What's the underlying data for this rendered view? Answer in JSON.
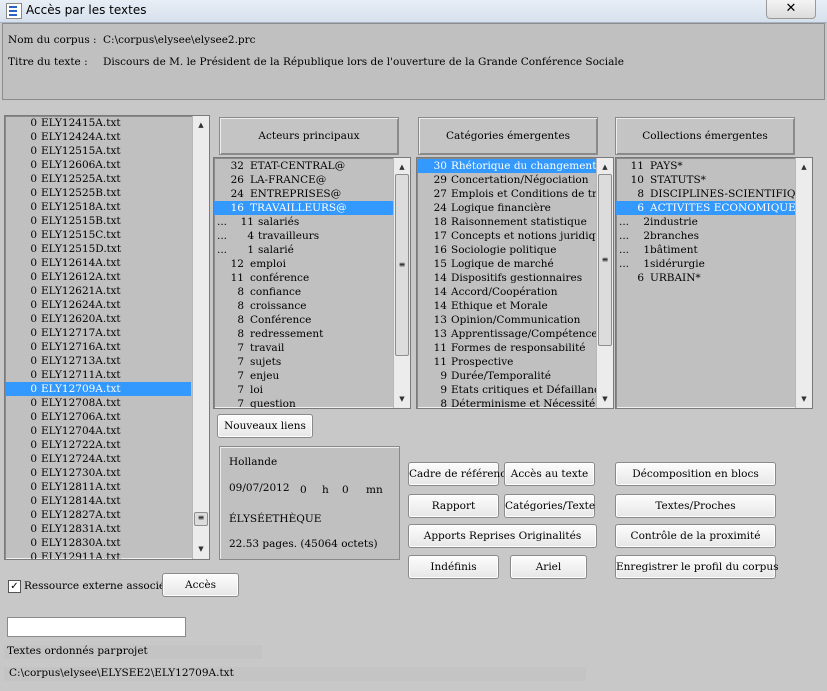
{
  "window": {
    "title": "Accès par les textes",
    "close_glyph": "✕"
  },
  "header": {
    "corpus_label": "Nom du corpus :",
    "corpus_value": "C:\\corpus\\elysee\\elysee2.prc",
    "titre_label": "Titre du texte :",
    "titre_value": "Discours de M. le Président de la République lors de l'ouverture de la Grande Conférence Sociale"
  },
  "files": {
    "items": [
      {
        "count": "0",
        "name": "ELY12415A.txt"
      },
      {
        "count": "0",
        "name": "ELY12424A.txt"
      },
      {
        "count": "0",
        "name": "ELY12515A.txt"
      },
      {
        "count": "0",
        "name": "ELY12606A.txt"
      },
      {
        "count": "0",
        "name": "ELY12525A.txt"
      },
      {
        "count": "0",
        "name": "ELY12525B.txt"
      },
      {
        "count": "0",
        "name": "ELY12518A.txt"
      },
      {
        "count": "0",
        "name": "ELY12515B.txt"
      },
      {
        "count": "0",
        "name": "ELY12515C.txt"
      },
      {
        "count": "0",
        "name": "ELY12515D.txt"
      },
      {
        "count": "0",
        "name": "ELY12614A.txt"
      },
      {
        "count": "0",
        "name": "ELY12612A.txt"
      },
      {
        "count": "0",
        "name": "ELY12621A.txt"
      },
      {
        "count": "0",
        "name": "ELY12624A.txt"
      },
      {
        "count": "0",
        "name": "ELY12620A.txt"
      },
      {
        "count": "0",
        "name": "ELY12717A.txt"
      },
      {
        "count": "0",
        "name": "ELY12716A.txt"
      },
      {
        "count": "0",
        "name": "ELY12713A.txt"
      },
      {
        "count": "0",
        "name": "ELY12711A.txt"
      },
      {
        "count": "0",
        "name": "ELY12709A.txt",
        "selected": true
      },
      {
        "count": "0",
        "name": "ELY12708A.txt"
      },
      {
        "count": "0",
        "name": "ELY12706A.txt"
      },
      {
        "count": "0",
        "name": "ELY12704A.txt"
      },
      {
        "count": "0",
        "name": "ELY12722A.txt"
      },
      {
        "count": "0",
        "name": "ELY12724A.txt"
      },
      {
        "count": "0",
        "name": "ELY12730A.txt"
      },
      {
        "count": "0",
        "name": "ELY12811A.txt"
      },
      {
        "count": "0",
        "name": "ELY12814A.txt"
      },
      {
        "count": "0",
        "name": "ELY12827A.txt"
      },
      {
        "count": "0",
        "name": "ELY12831A.txt"
      },
      {
        "count": "0",
        "name": "ELY12830A.txt"
      },
      {
        "count": "0",
        "name": "ELY12911A.txt"
      }
    ]
  },
  "actors": {
    "header": "Acteurs principaux",
    "items": [
      {
        "prefix": "",
        "count": "32",
        "label": "ETAT-CENTRAL@"
      },
      {
        "prefix": "",
        "count": "26",
        "label": "LA-FRANCE@"
      },
      {
        "prefix": "",
        "count": "24",
        "label": "ENTREPRISES@"
      },
      {
        "prefix": "",
        "count": "16",
        "label": "TRAVAILLEURS@",
        "selected": true
      },
      {
        "prefix": "...",
        "count": "11",
        "label": "salariés",
        "small": true
      },
      {
        "prefix": "...",
        "count": "4",
        "label": "travailleurs",
        "small": true
      },
      {
        "prefix": "...",
        "count": "1",
        "label": "salarié",
        "small": true
      },
      {
        "prefix": "",
        "count": "12",
        "label": "emploi"
      },
      {
        "prefix": "",
        "count": "11",
        "label": "conférence"
      },
      {
        "prefix": "",
        "count": "8",
        "label": "confiance"
      },
      {
        "prefix": "",
        "count": "8",
        "label": "croissance"
      },
      {
        "prefix": "",
        "count": "8",
        "label": "Conférence"
      },
      {
        "prefix": "",
        "count": "8",
        "label": "redressement"
      },
      {
        "prefix": "",
        "count": "7",
        "label": "travail"
      },
      {
        "prefix": "",
        "count": "7",
        "label": "sujets"
      },
      {
        "prefix": "",
        "count": "7",
        "label": "enjeu"
      },
      {
        "prefix": "",
        "count": "7",
        "label": "loi"
      },
      {
        "prefix": "",
        "count": "7",
        "label": "question"
      }
    ]
  },
  "categories": {
    "header": "Catégories émergentes",
    "items": [
      {
        "count": "30",
        "label": "Rhétorique du changement",
        "selected": true
      },
      {
        "count": "29",
        "label": "Concertation/Négociation"
      },
      {
        "count": "27",
        "label": "Emplois et Conditions de trava"
      },
      {
        "count": "24",
        "label": "Logique financière"
      },
      {
        "count": "18",
        "label": "Raisonnement statistique"
      },
      {
        "count": "17",
        "label": "Concepts et notions juridiques"
      },
      {
        "count": "16",
        "label": "Sociologie politique"
      },
      {
        "count": "15",
        "label": "Logique de marché"
      },
      {
        "count": "14",
        "label": "Dispositifs gestionnaires"
      },
      {
        "count": "14",
        "label": "Accord/Coopération"
      },
      {
        "count": "14",
        "label": "Ethique et Morale"
      },
      {
        "count": "13",
        "label": "Opinion/Communication"
      },
      {
        "count": "13",
        "label": "Apprentissage/Compétence"
      },
      {
        "count": "11",
        "label": "Formes de responsabilité"
      },
      {
        "count": "11",
        "label": "Prospective"
      },
      {
        "count": "9",
        "label": "Durée/Temporalité"
      },
      {
        "count": "9",
        "label": "Etats critiques et Défaillances"
      },
      {
        "count": "8",
        "label": "Déterminisme et Nécessité"
      }
    ]
  },
  "collections": {
    "header": "Collections émergentes",
    "items": [
      {
        "prefix": "",
        "count": "11",
        "label": "PAYS*"
      },
      {
        "prefix": "",
        "count": "10",
        "label": "STATUTS*"
      },
      {
        "prefix": "",
        "count": "8",
        "label": "DISCIPLINES-SCIENTIFIQUE"
      },
      {
        "prefix": "",
        "count": "6",
        "label": "ACTIVITES ECONOMIQUES*",
        "selected": true
      },
      {
        "prefix": "...",
        "count": "2",
        "label": "industrie",
        "small": true
      },
      {
        "prefix": "...",
        "count": "2",
        "label": "branches",
        "small": true
      },
      {
        "prefix": "...",
        "count": "1",
        "label": "bâtiment",
        "small": true
      },
      {
        "prefix": "...",
        "count": "1",
        "label": "sidérurgie",
        "small": true
      },
      {
        "prefix": "",
        "count": "6",
        "label": "URBAIN*"
      }
    ]
  },
  "info": {
    "author": "Hollande",
    "date": "09/07/2012",
    "hours": "0",
    "h_label": "h",
    "minutes": "0",
    "mn_label": "mn",
    "source": "ÉLYSÉETHÈQUE",
    "size": "22.53 pages. (45064 octets)"
  },
  "buttons": {
    "nouveaux_liens": "Nouveaux liens",
    "cadre": "Cadre de référence",
    "acces_texte": "Accès au texte",
    "rapport": "Rapport",
    "categories_texte": "Catégories/Texte",
    "apports": "Apports Reprises Originalités",
    "indefinis": "Indéfinis",
    "ariel": "Ariel",
    "decomposition": "Décomposition en blocs",
    "textes_proches": "Textes/Proches",
    "controle": "Contrôle de la proximité",
    "enregistrer": "Enregistrer le profil du corpus",
    "acces": "Accès"
  },
  "footer": {
    "ressource_label": "Ressource externe associée",
    "ressource_checked": "✓",
    "search_value": "",
    "ordonnes_label": "Textes ordonnés par :",
    "ordonnes_value": "projet",
    "path": "C:\\corpus\\elysee\\ELYSEE2\\ELY12709A.txt"
  }
}
